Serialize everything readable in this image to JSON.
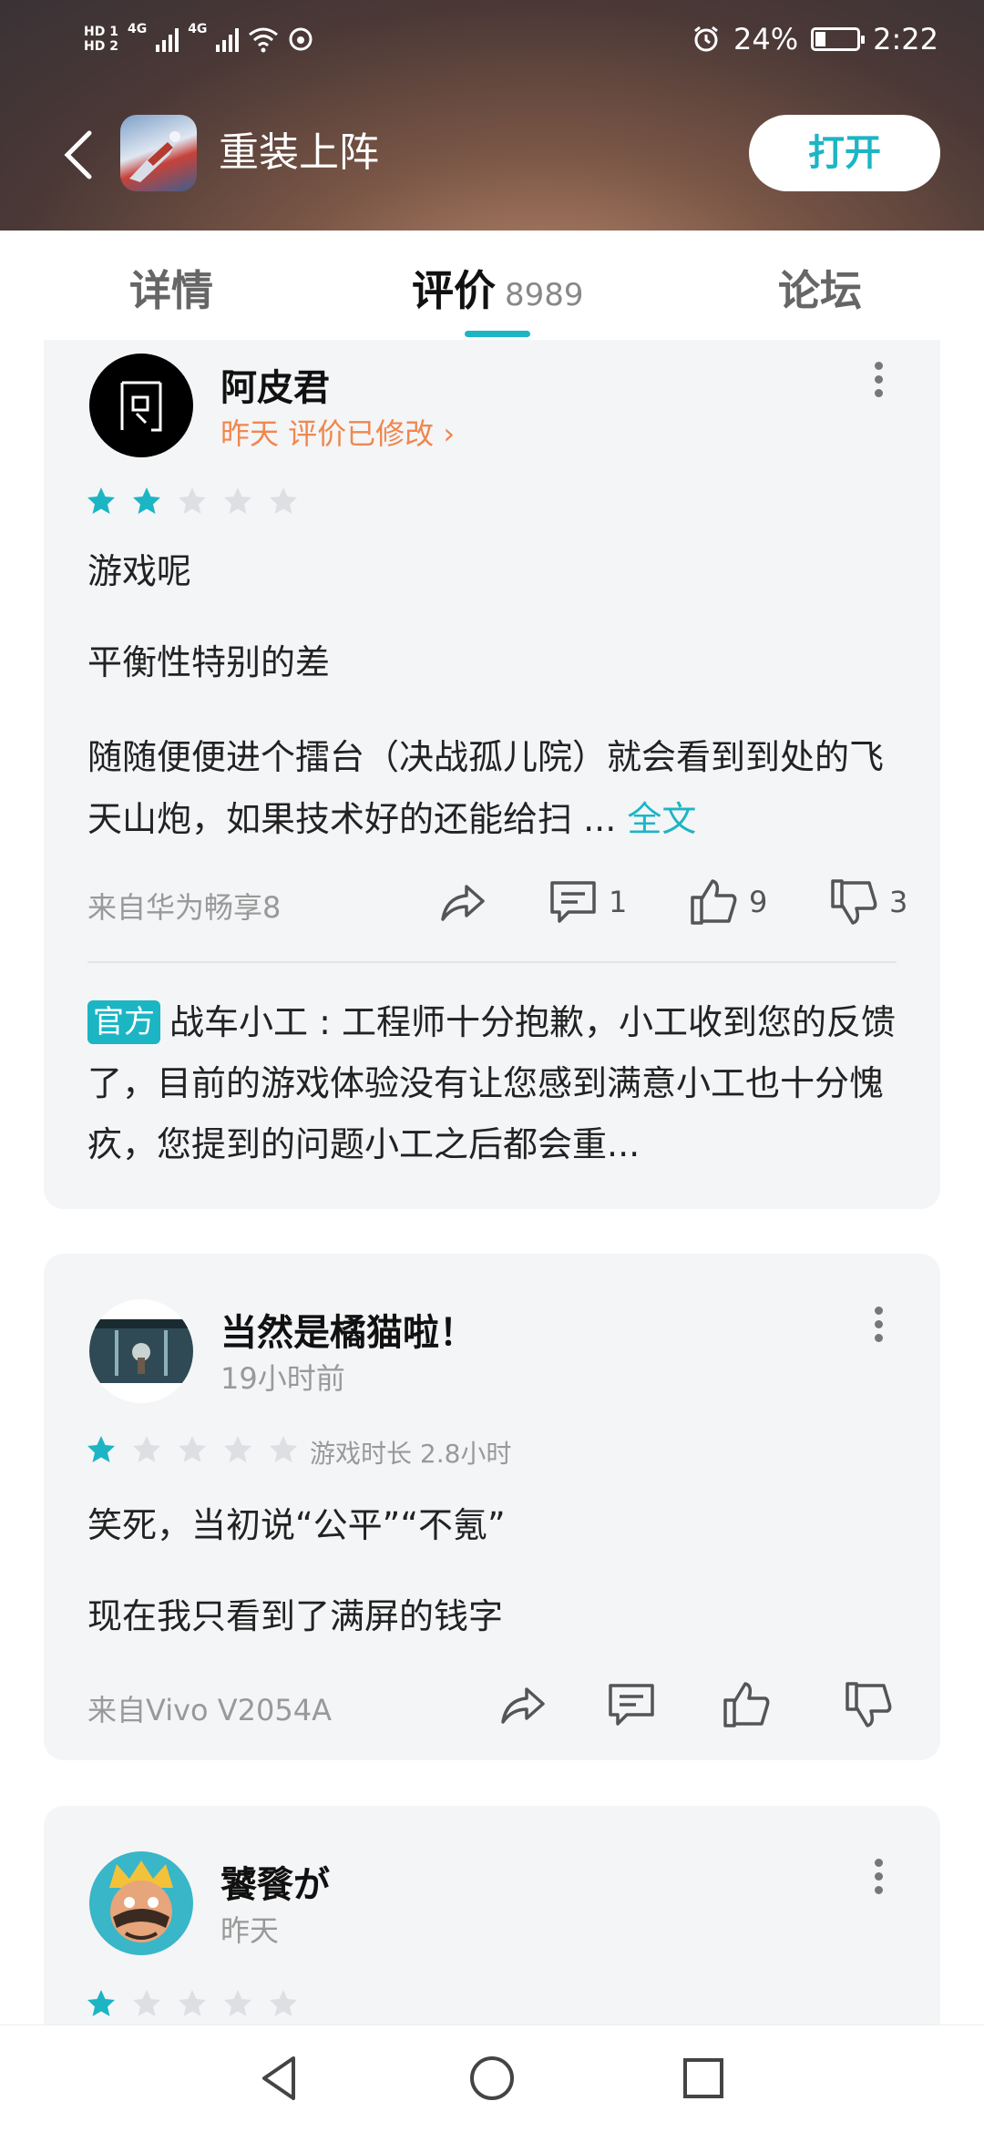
{
  "status_bar": {
    "hd1": "HD 1",
    "hd2": "HD 2",
    "net1": "4G",
    "net2": "4G",
    "battery": "24%",
    "battery_fraction": 0.24,
    "time": "2:22"
  },
  "header": {
    "back_icon": "back-arrow-icon",
    "app_name": "重装上阵",
    "open_label": "打开"
  },
  "tabs": [
    {
      "label": "详情"
    },
    {
      "label": "评价",
      "count": "8989",
      "active": true
    },
    {
      "label": "论坛"
    }
  ],
  "reviews": [
    {
      "user": "阿皮君",
      "date": "昨天 评价已修改",
      "rating": 2,
      "paragraphs": [
        "游戏呢",
        "平衡性特别的差"
      ],
      "body": "随随便便进个擂台（决战孤儿院）就会看到到处的飞天山炮，如果技术好的还能给扫 ...",
      "more_label": "全文",
      "device": "来自华为畅享8",
      "comments": "1",
      "likes": "9",
      "dislikes": "3",
      "official_tag": "官方",
      "official_reply": "战车小工 : 工程师十分抱歉，小工收到您的反馈了，目前的游戏体验没有让您感到满意小工也十分愧疚，您提到的问题小工之后都会重..."
    },
    {
      "user": "当然是橘猫啦！",
      "date": "19小时前",
      "rating": 1,
      "playtime": "游戏时长 2.8小时",
      "paragraphs": [
        "笑死，当初说“公平”“不氪”",
        "现在我只看到了满屏的钱字"
      ],
      "device": "来自Vivo V2054A"
    },
    {
      "user": "饕餮が",
      "date": "昨天",
      "rating": 1
    }
  ],
  "colors": {
    "accent": "#1cb5c4",
    "orange": "#f0874c",
    "card_bg": "#f4f5f7"
  }
}
